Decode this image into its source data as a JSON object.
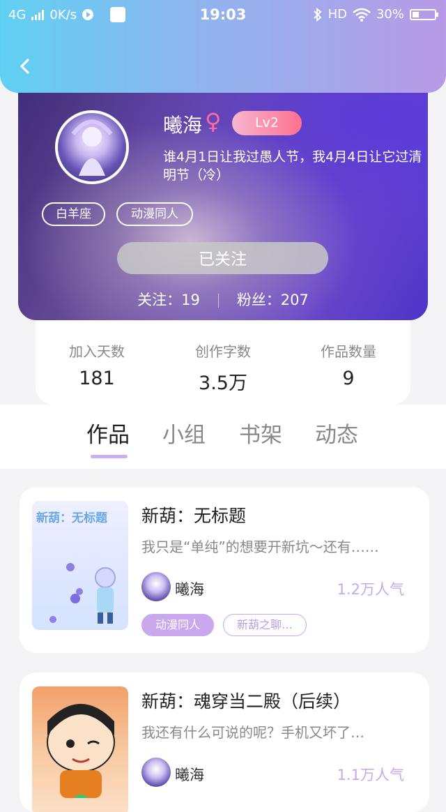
{
  "status_bar": {
    "network": "4G",
    "speed": "0K/s",
    "time": "19:03",
    "hd": "HD",
    "battery": "30%"
  },
  "profile": {
    "nickname": "曦海",
    "gender_symbol": "♀",
    "level": "Lv2",
    "signature": "谁4月1日让我过愚人节，我4月4日让它过清\n明节（冷）",
    "tags": [
      "白羊座",
      "动漫同人"
    ],
    "follow_button": "已关注",
    "following_label": "关注：19",
    "followers_label": "粉丝：207"
  },
  "stats": [
    {
      "label": "加入天数",
      "value": "181"
    },
    {
      "label": "创作字数",
      "value": "3.5万"
    },
    {
      "label": "作品数量",
      "value": "9"
    }
  ],
  "tabs": [
    "作品",
    "小组",
    "书架",
    "动态"
  ],
  "works": [
    {
      "cover_text": "新葫：无标题",
      "title": "新葫：无标题",
      "desc": "我只是“单纯”的想要开新坑～还有……",
      "author": "曦海",
      "popularity": "1.2万人气",
      "tags": [
        "动漫同人",
        "新葫之聊…"
      ]
    },
    {
      "title": "新葫：魂穿当二殿（后续）",
      "desc": "我还有什么可说的呢？手机又坏了…",
      "author": "曦海",
      "popularity": "1.1万人气"
    }
  ],
  "colors": {
    "accent": "#c9a8ee",
    "lv_badge": "#ff7090",
    "header_start": "#5fd0f3",
    "header_end": "#b89ae6"
  }
}
